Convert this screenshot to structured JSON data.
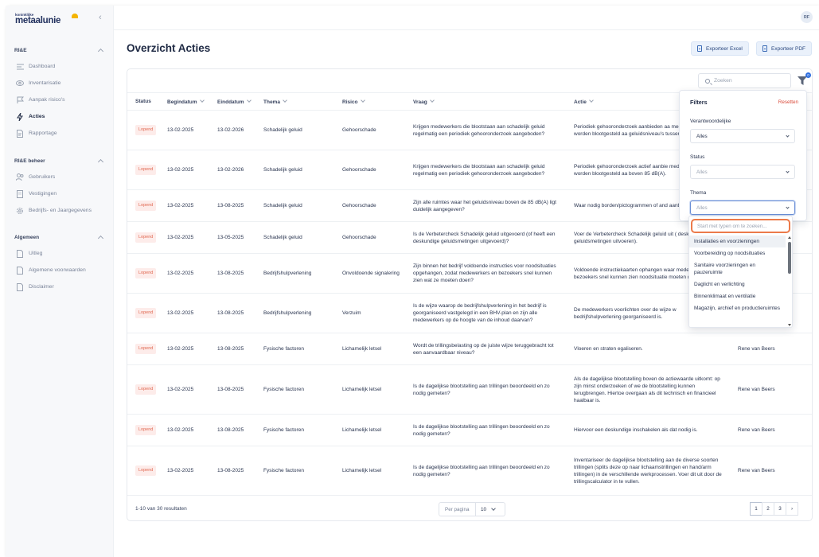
{
  "brand": {
    "small": "koninklijke",
    "name": "metaalunie"
  },
  "user": {
    "initials": "RF"
  },
  "sidebar": {
    "sections": [
      {
        "title": "RI&E",
        "items": [
          {
            "label": "Dashboard",
            "icon": "dashboard-icon"
          },
          {
            "label": "Inventarisatie",
            "icon": "eye-icon"
          },
          {
            "label": "Aanpak risico's",
            "icon": "flag-icon"
          },
          {
            "label": "Acties",
            "icon": "lightning-icon"
          },
          {
            "label": "Rapportage",
            "icon": "document-icon"
          }
        ]
      },
      {
        "title": "RI&E beheer",
        "items": [
          {
            "label": "Gebruikers",
            "icon": "users-icon"
          },
          {
            "label": "Vestigingen",
            "icon": "building-icon"
          },
          {
            "label": "Bedrijfs- en Jaargegevens",
            "icon": "gear-icon"
          }
        ]
      },
      {
        "title": "Algemeen",
        "items": [
          {
            "label": "Uitleg",
            "icon": "document-icon"
          },
          {
            "label": "Algemene voorwaarden",
            "icon": "document-icon"
          },
          {
            "label": "Disclaimer",
            "icon": "document-icon"
          }
        ]
      }
    ]
  },
  "page": {
    "title": "Overzicht Acties",
    "export_excel": "Exporteer Excel",
    "export_pdf": "Exporteer PDF"
  },
  "search": {
    "placeholder": "Zoeken"
  },
  "filter_count": "0",
  "table": {
    "columns": [
      "Status",
      "Begindatum",
      "Einddatum",
      "Thema",
      "Risico",
      "Vraag",
      "Actie"
    ],
    "rows": [
      {
        "status": "Lopend",
        "begin": "13-02-2025",
        "end": "13-02-2026",
        "thema": "Schadelijk geluid",
        "risico": "Gehoorschade",
        "vraag": "Krijgen medewerkers die blootstaan aan schadelijk geluid regelmatig een periodiek gehooronderzoek aangeboden?",
        "actie": "Periodiek gehooronderzoek aanbieden aa medewerkers die worden blootgesteld aa geluidsniveau's tussen 80 dB(A) en 85 dB",
        "owner": ""
      },
      {
        "status": "Lopend",
        "begin": "13-02-2025",
        "end": "13-02-2026",
        "thema": "Schadelijk geluid",
        "risico": "Gehoorschade",
        "vraag": "Krijgen medewerkers die blootstaan aan schadelijk geluid regelmatig een periodiek gehooronderzoek aangeboden?",
        "actie": "Periodiek gehooronderzoek actief aanbie medewerkers die worden blootgesteld aa boven 85 dB(A).",
        "owner": ""
      },
      {
        "status": "Lopend",
        "begin": "13-02-2025",
        "end": "13-08-2025",
        "thema": "Schadelijk geluid",
        "risico": "Gehoorschade",
        "vraag": "Zijn alle ruimtes waar het geluidsniveau boven de 85 dB(A) ligt duidelijk aangegeven?",
        "actie": "Waar nodig borden/pictogrammen of and aanbrengen.",
        "owner": ""
      },
      {
        "status": "Lopend",
        "begin": "13-02-2025",
        "end": "13-05-2025",
        "thema": "Schadelijk geluid",
        "risico": "Gehoorschade",
        "vraag": "Is de Verbetercheck Schadelijk geluid uitgevoerd (of heeft een deskundige geluidsmetingen uitgevoerd)?",
        "actie": "Voer de Verbetercheck Schadelijk geluid uit ( deskundige geluidsmetingen uitvoeren).",
        "owner": ""
      },
      {
        "status": "Lopend",
        "begin": "13-02-2025",
        "end": "13-08-2025",
        "thema": "Bedrijfshulpverlening",
        "risico": "Onvoldoende signalering",
        "vraag": "Zijn binnen het bedrijf voldoende instructies voor noodsituaties opgehangen, zodat medewerkers en bezoekers snel kunnen zien wat ze moeten doen?",
        "actie": "Voldoende instructiekaarten ophangen waar medewerkers en bezoekers snel kunnen zien noodsituatie moeten doen.",
        "owner": ""
      },
      {
        "status": "Lopend",
        "begin": "13-02-2025",
        "end": "13-08-2025",
        "thema": "Bedrijfshulpverlening",
        "risico": "Verzuim",
        "vraag": "Is de wijze waarop de bedrijfshulpverlening in het bedrijf is georganiseerd vastgelegd in een BHV-plan en zijn alle medewerkers op de hoogte van de inhoud daarvan?",
        "actie": "De medewerkers voorlichten over de wijze w bedrijfshulpverlening georganiseerd is.",
        "owner": ""
      },
      {
        "status": "Lopend",
        "begin": "13-02-2025",
        "end": "13-08-2025",
        "thema": "Fysische factoren",
        "risico": "Lichamelijk letsel",
        "vraag": "Wordt de trillingsbelasting op de juiste wijze teruggebracht tot een aanvaardbaar niveau?",
        "actie": "Vloeren en straten egaliseren.",
        "owner": "Rene van Beers"
      },
      {
        "status": "Lopend",
        "begin": "13-02-2025",
        "end": "13-08-2025",
        "thema": "Fysische factoren",
        "risico": "Lichamelijk letsel",
        "vraag": "Is de dagelijkse blootstelling aan trillingen beoordeeld en zo nodig gemeten?",
        "actie": "Als de dagelijkse blootstelling boven de actiewaarde uitkomt: op zijn minst onderzoeken of we de blootstelling kunnen terugbrengen. Hiertoe overgaan als dit technisch en financieel haalbaar is.",
        "owner": "Rene van Beers"
      },
      {
        "status": "Lopend",
        "begin": "13-02-2025",
        "end": "13-08-2025",
        "thema": "Fysische factoren",
        "risico": "Lichamelijk letsel",
        "vraag": "Is de dagelijkse blootstelling aan trillingen beoordeeld en zo nodig gemeten?",
        "actie": "Hiervoor een deskundige inschakelen als dat nodig is.",
        "owner": "Rene van Beers"
      },
      {
        "status": "Lopend",
        "begin": "13-02-2025",
        "end": "13-08-2025",
        "thema": "Fysische factoren",
        "risico": "Lichamelijk letsel",
        "vraag": "Is de dagelijkse blootstelling aan trillingen beoordeeld en zo nodig gemeten?",
        "actie": "Inventariseer de dagelijkse blootstelling aan de diverse soorten trillingen (splits deze op naar lichaamstrillingen en hand/arm trillingen) in de verschillende werkprocessen. Voer dit uit door de trillingscalculator in te vullen.",
        "owner": "Rene van Beers"
      }
    ]
  },
  "pagination": {
    "summary": "1-10 van 30 resultaten",
    "per_page_label": "Per pagina",
    "per_page_value": "10",
    "pages": [
      "1",
      "2",
      "3"
    ],
    "next": "›"
  },
  "filters": {
    "title": "Filters",
    "reset": "Resetten",
    "fields": [
      {
        "label": "Verantwoordelijke",
        "value": "Alles"
      },
      {
        "label": "Status",
        "value": "Alles"
      },
      {
        "label": "Thema",
        "value": "Alles"
      }
    ],
    "dropdown": {
      "placeholder": "Start met typen om te zoeken...",
      "options": [
        "Installaties en voorzieningen",
        "Voorbereiding op noodsituaties",
        "Sanitaire voorzieningen en pauzeruimte",
        "Daglicht en verlichting",
        "Binnenklimaat en ventilatie",
        "Magazijn, archief en productieruimtes"
      ]
    }
  },
  "colors": {
    "accent": "#2f6fdf",
    "status_badge": "#e0674f",
    "focus_ring": "#ec7a4a",
    "reset": "#d94838"
  }
}
